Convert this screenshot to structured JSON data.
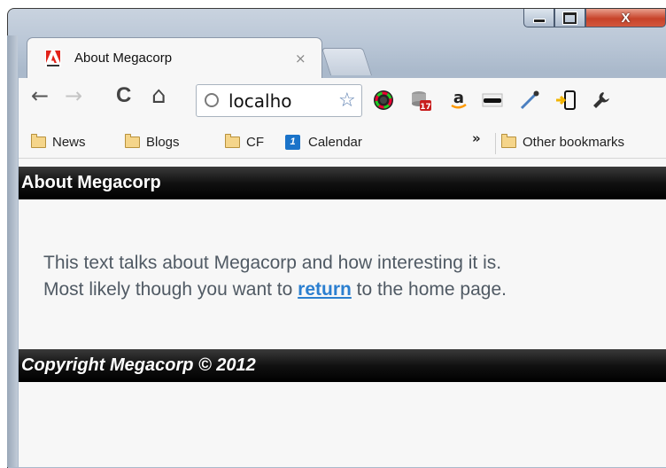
{
  "window": {
    "controls": {
      "close_glyph": "X"
    }
  },
  "tab": {
    "title": "About Megacorp",
    "close_glyph": "×",
    "favicon": "adobe-icon"
  },
  "toolbar": {
    "back_glyph": "←",
    "forward_glyph": "→",
    "reload_glyph": "C",
    "home_glyph": "⌂",
    "url_text": "localho",
    "extensions": [
      "color-picker-icon",
      "database-icon",
      "amazon-icon",
      "spy-icon",
      "eyedropper-icon",
      "mobile-send-icon",
      "wrench-icon"
    ],
    "calendar_badge": "17",
    "amazon_letter": "a"
  },
  "bookmarks": {
    "items": [
      {
        "label": "News",
        "icon": "folder-icon"
      },
      {
        "label": "Blogs",
        "icon": "folder-icon"
      },
      {
        "label": "CF",
        "icon": "folder-icon"
      },
      {
        "label": "Calendar",
        "icon": "calendar-icon",
        "badge": "1"
      }
    ],
    "overflow": "»",
    "other_label": "Other bookmarks"
  },
  "page": {
    "header": "About Megacorp",
    "line1": "This text talks about Megacorp and how interesting it is.",
    "line2_before": "Most likely though you want to ",
    "link": "return",
    "line2_after": " to the home page.",
    "footer": "Copyright Megacorp © 2012"
  },
  "colors": {
    "header_bg": "#000000",
    "link": "#2b7fd0",
    "body_text": "#505a64",
    "close_button": "#c7432a"
  }
}
